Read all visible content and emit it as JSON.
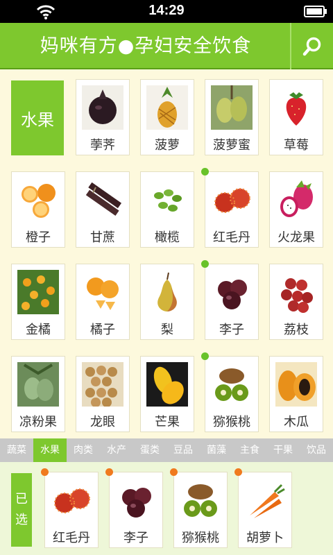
{
  "status": {
    "time": "14:29"
  },
  "header": {
    "title": "妈咪有方●孕妇安全饮食"
  },
  "category": {
    "label": "水果"
  },
  "grid": [
    {
      "name": "荸荠",
      "image": "water-chestnut",
      "marked": false
    },
    {
      "name": "菠萝",
      "image": "pineapple",
      "marked": false
    },
    {
      "name": "菠萝蜜",
      "image": "jackfruit",
      "marked": false
    },
    {
      "name": "草莓",
      "image": "strawberry",
      "marked": false
    },
    {
      "name": "橙子",
      "image": "orange",
      "marked": false
    },
    {
      "name": "甘蔗",
      "image": "sugarcane",
      "marked": false
    },
    {
      "name": "橄榄",
      "image": "olive",
      "marked": false
    },
    {
      "name": "红毛丹",
      "image": "rambutan",
      "marked": true
    },
    {
      "name": "火龙果",
      "image": "dragon-fruit",
      "marked": false
    },
    {
      "name": "金橘",
      "image": "kumquat",
      "marked": false
    },
    {
      "name": "橘子",
      "image": "tangerine",
      "marked": false
    },
    {
      "name": "梨",
      "image": "pear",
      "marked": false
    },
    {
      "name": "李子",
      "image": "plum",
      "marked": true
    },
    {
      "name": "荔枝",
      "image": "lychee",
      "marked": false
    },
    {
      "name": "凉粉果",
      "image": "jelly-fig",
      "marked": false
    },
    {
      "name": "龙眼",
      "image": "longan",
      "marked": false
    },
    {
      "name": "芒果",
      "image": "mango",
      "marked": false
    },
    {
      "name": "猕猴桃",
      "image": "kiwi",
      "marked": true
    },
    {
      "name": "木瓜",
      "image": "papaya",
      "marked": false
    }
  ],
  "tabs": [
    {
      "label": "蔬菜",
      "active": false
    },
    {
      "label": "水果",
      "active": true
    },
    {
      "label": "肉类",
      "active": false
    },
    {
      "label": "水产",
      "active": false
    },
    {
      "label": "蛋类",
      "active": false
    },
    {
      "label": "豆品",
      "active": false
    },
    {
      "label": "菌藻",
      "active": false
    },
    {
      "label": "主食",
      "active": false
    },
    {
      "label": "干果",
      "active": false
    },
    {
      "label": "饮品",
      "active": false
    }
  ],
  "selected": {
    "label_chars": [
      "已",
      "选"
    ],
    "items": [
      {
        "name": "红毛丹",
        "image": "rambutan"
      },
      {
        "name": "李子",
        "image": "plum"
      },
      {
        "name": "猕猴桃",
        "image": "kiwi"
      },
      {
        "name": "胡萝卜",
        "image": "carrot"
      }
    ]
  },
  "colors": {
    "accent": "#7ec82e",
    "background": "#fdf9dd",
    "dot_green": "#68c22a",
    "dot_orange": "#f07a1e",
    "tab_bar": "#c8c8c8"
  }
}
